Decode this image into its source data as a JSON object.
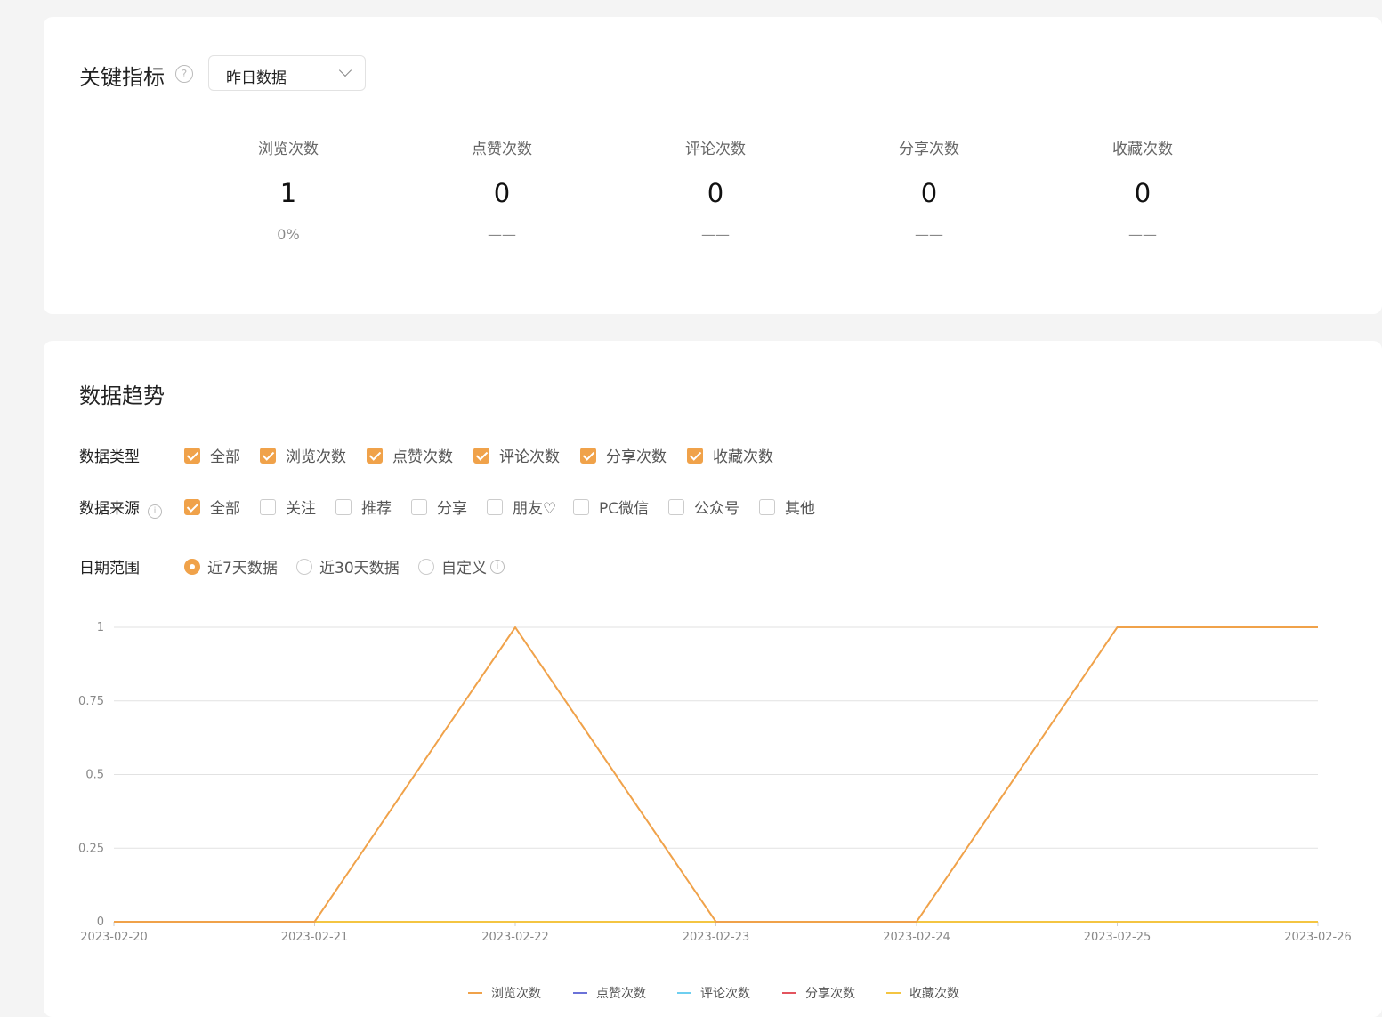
{
  "key_metrics": {
    "title": "关键指标",
    "help": "?",
    "period_select": "昨日数据",
    "items": [
      {
        "label": "浏览次数",
        "value": "1",
        "change": "0%"
      },
      {
        "label": "点赞次数",
        "value": "0",
        "change": "——"
      },
      {
        "label": "评论次数",
        "value": "0",
        "change": "——"
      },
      {
        "label": "分享次数",
        "value": "0",
        "change": "——"
      },
      {
        "label": "收藏次数",
        "value": "0",
        "change": "——"
      }
    ]
  },
  "trend": {
    "title": "数据趋势",
    "data_type": {
      "label": "数据类型",
      "options": [
        {
          "label": "全部",
          "checked": true
        },
        {
          "label": "浏览次数",
          "checked": true
        },
        {
          "label": "点赞次数",
          "checked": true
        },
        {
          "label": "评论次数",
          "checked": true
        },
        {
          "label": "分享次数",
          "checked": true
        },
        {
          "label": "收藏次数",
          "checked": true
        }
      ]
    },
    "data_source": {
      "label": "数据来源",
      "info": "i",
      "options": [
        {
          "label": "全部",
          "checked": true
        },
        {
          "label": "关注",
          "checked": false
        },
        {
          "label": "推荐",
          "checked": false
        },
        {
          "label": "分享",
          "checked": false
        },
        {
          "label": "朋友♡",
          "checked": false
        },
        {
          "label": "PC微信",
          "checked": false
        },
        {
          "label": "公众号",
          "checked": false
        },
        {
          "label": "其他",
          "checked": false
        }
      ]
    },
    "date_range": {
      "label": "日期范围",
      "info": "i",
      "options": [
        {
          "label": "近7天数据",
          "selected": true
        },
        {
          "label": "近30天数据",
          "selected": false
        },
        {
          "label": "自定义",
          "selected": false
        }
      ]
    }
  },
  "chart_data": {
    "type": "line",
    "x": [
      "2023-02-20",
      "2023-02-21",
      "2023-02-22",
      "2023-02-23",
      "2023-02-24",
      "2023-02-25",
      "2023-02-26"
    ],
    "ylim": [
      0,
      1
    ],
    "yticks": [
      "0",
      "0.25",
      "0.5",
      "0.75",
      "1"
    ],
    "grid": true,
    "legend_position": "bottom",
    "series": [
      {
        "name": "浏览次数",
        "color": "#f0a24a",
        "values": [
          0,
          0,
          1,
          0,
          0,
          1,
          1
        ]
      },
      {
        "name": "点赞次数",
        "color": "#6b72d8",
        "values": [
          0,
          0,
          0,
          0,
          0,
          0,
          0
        ]
      },
      {
        "name": "评论次数",
        "color": "#6ecff0",
        "values": [
          0,
          0,
          0,
          0,
          0,
          0,
          0
        ]
      },
      {
        "name": "分享次数",
        "color": "#e3545e",
        "values": [
          0,
          0,
          0,
          0,
          0,
          0,
          0
        ]
      },
      {
        "name": "收藏次数",
        "color": "#f4c542",
        "values": [
          0,
          0,
          0,
          0,
          0,
          0,
          0
        ]
      }
    ]
  }
}
